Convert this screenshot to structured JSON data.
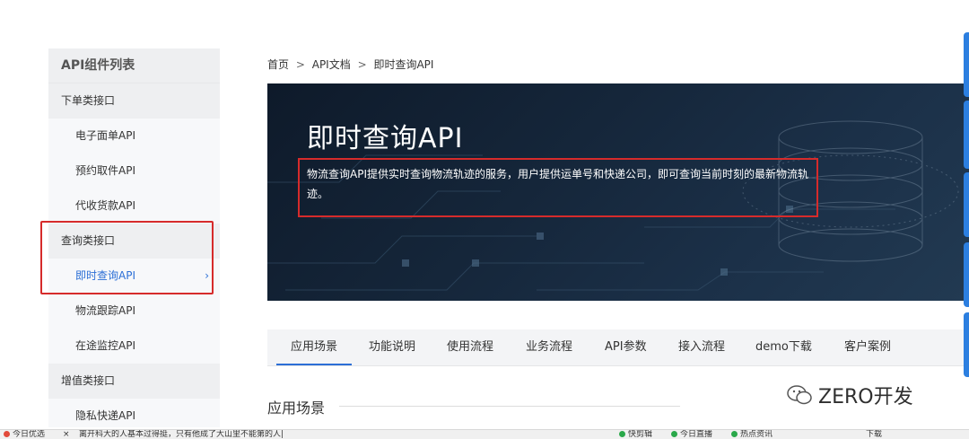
{
  "sidebar": {
    "title": "API组件列表",
    "groups": [
      {
        "label": "下单类接口",
        "items": [
          "电子面单API",
          "预约取件API",
          "代收货款API"
        ]
      },
      {
        "label": "查询类接口",
        "items": [
          "即时查询API",
          "物流跟踪API",
          "在途监控API"
        ]
      },
      {
        "label": "增值类接口",
        "items": [
          "隐私快递API"
        ]
      }
    ],
    "active_chevron": "›"
  },
  "breadcrumb": {
    "items": [
      "首页",
      "API文档",
      "即时查询API"
    ],
    "sep": ">"
  },
  "banner": {
    "title": "即时查询API",
    "desc": "物流查询API提供实时查询物流轨迹的服务，用户提供运单号和快递公司，即可查询当前时刻的最新物流轨迹。"
  },
  "tabs": [
    "应用场景",
    "功能说明",
    "使用流程",
    "业务流程",
    "API参数",
    "接入流程",
    "demo下载",
    "客户案例"
  ],
  "section": {
    "heading": "应用场景"
  },
  "watermark": {
    "text": "ZERO开发"
  },
  "taskbar": {
    "left1": "今日优选",
    "left2": "×",
    "left3": "离开科大的人基本过得挺，只有他成了大山里不能第的人|",
    "r1": "快剪辑",
    "r2": "今日直播",
    "r3": "热点资讯",
    "r4": "下载"
  },
  "colors": {
    "accent": "#2c6fd6",
    "highlight_box": "#d62b2b",
    "banner_bg": "#15263a"
  }
}
